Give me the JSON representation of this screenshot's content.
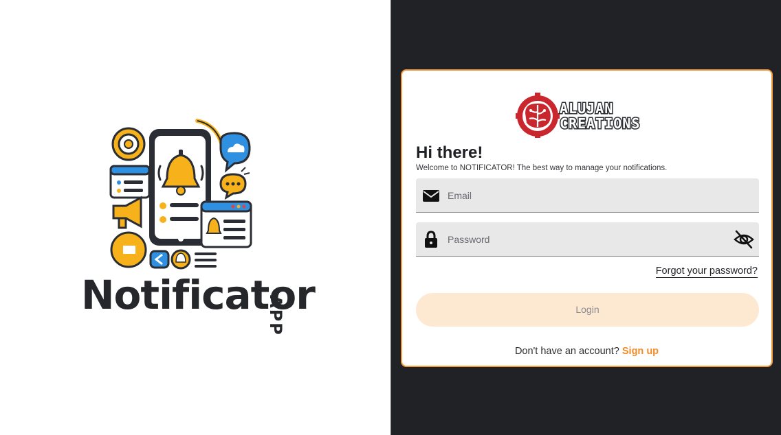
{
  "brand": {
    "name": "Notificator",
    "tag": "APP"
  },
  "logo": {
    "text_line1": "ALUJAN",
    "text_line2": "CREATIONS"
  },
  "login": {
    "greeting": "Hi there!",
    "subtitle": "Welcome to NOTIFICATOR! The best way to manage your notifications.",
    "email_placeholder": "Email",
    "email_value": "",
    "email_icon": "envelope-icon",
    "password_placeholder": "Password",
    "password_value": "",
    "password_icon": "lock-icon",
    "visibility_icon": "eye-off-icon",
    "forgot_label": "Forgot your password?",
    "login_label": "Login",
    "signup_prompt": "Don't have an account?",
    "signup_label": "Sign up"
  },
  "colors": {
    "accent": "#f28c28",
    "card_border": "#f29a3c",
    "right_bg": "#212226",
    "button_bg": "#fde8d2",
    "field_bg": "#e8e8e9"
  }
}
